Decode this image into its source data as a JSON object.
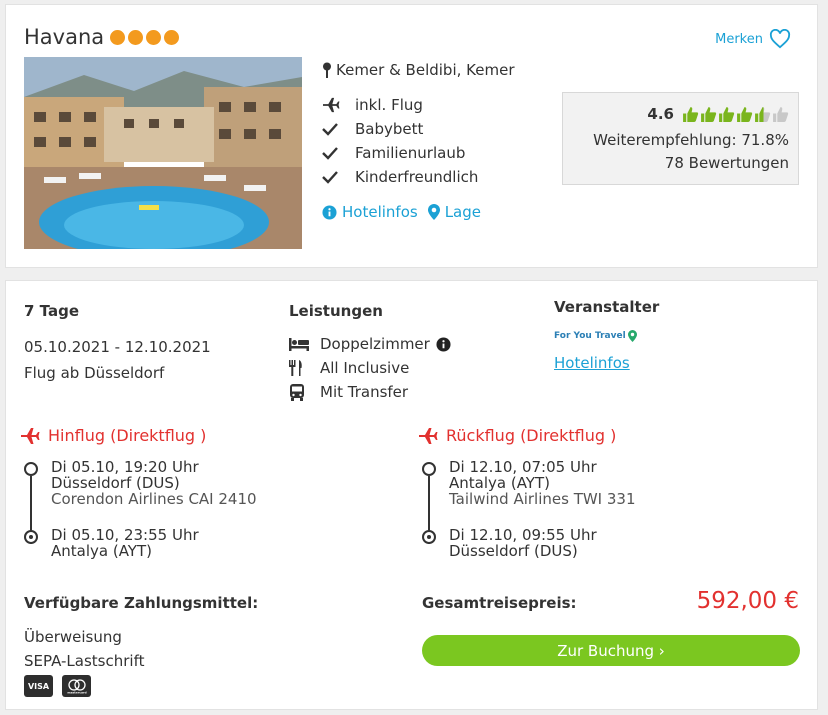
{
  "hotel": {
    "name": "Havana",
    "stars": 4,
    "merken_label": "Merken",
    "location": "Kemer & Beldibi, Kemer",
    "features": [
      {
        "icon": "plane-icon",
        "label": "inkl. Flug"
      },
      {
        "icon": "check-icon",
        "label": "Babybett"
      },
      {
        "icon": "check-icon",
        "label": "Familienurlaub"
      },
      {
        "icon": "check-icon",
        "label": "Kinderfreundlich"
      }
    ],
    "links": {
      "hotelinfos": "Hotelinfos",
      "lage": "Lage"
    }
  },
  "rating": {
    "score": "4.6",
    "thumbs_filled": 4.5,
    "thumbs_total": 6,
    "recommendation": "Weiterempfehlung: 71.8%",
    "reviews": "78 Bewertungen"
  },
  "trip": {
    "duration": "7 Tage",
    "dates": "05.10.2021 - 12.10.2021",
    "departure": "Flug ab Düsseldorf"
  },
  "services": {
    "heading": "Leistungen",
    "items": [
      {
        "icon": "bed-icon",
        "label": "Doppelzimmer"
      },
      {
        "icon": "cutlery-icon",
        "label": "All Inclusive"
      },
      {
        "icon": "bus-icon",
        "label": "Mit Transfer"
      }
    ]
  },
  "operator": {
    "heading": "Veranstalter",
    "brand": "For You Travel",
    "link": "Hotelinfos"
  },
  "flights": {
    "outbound": {
      "heading": "Hinflug (Direktflug )",
      "dep_time": "Di 05.10, 19:20 Uhr",
      "dep_airport": "Düsseldorf (DUS)",
      "airline": "Corendon Airlines CAI 2410",
      "arr_time": "Di 05.10, 23:55 Uhr",
      "arr_airport": "Antalya (AYT)"
    },
    "return": {
      "heading": "Rückflug (Direktflug )",
      "dep_time": "Di 12.10, 07:05 Uhr",
      "dep_airport": "Antalya (AYT)",
      "airline": "Tailwind Airlines TWI 331",
      "arr_time": "Di 12.10, 09:55 Uhr",
      "arr_airport": "Düsseldorf (DUS)"
    }
  },
  "payment": {
    "heading": "Verfügbare Zahlungsmittel:",
    "methods": [
      "Überweisung",
      "SEPA-Lastschrift"
    ],
    "cards": [
      "VISA",
      "mastercard"
    ]
  },
  "price": {
    "label": "Gesamtreisepreis:",
    "value": "592,00 €"
  },
  "booking": {
    "button_label": "Zur Buchung ›"
  },
  "colors": {
    "accent_blue": "#1ba1d5",
    "accent_red": "#e2312f",
    "star_orange": "#f39a1e",
    "thumb_green": "#7ab51d",
    "book_green": "#7bc720"
  }
}
